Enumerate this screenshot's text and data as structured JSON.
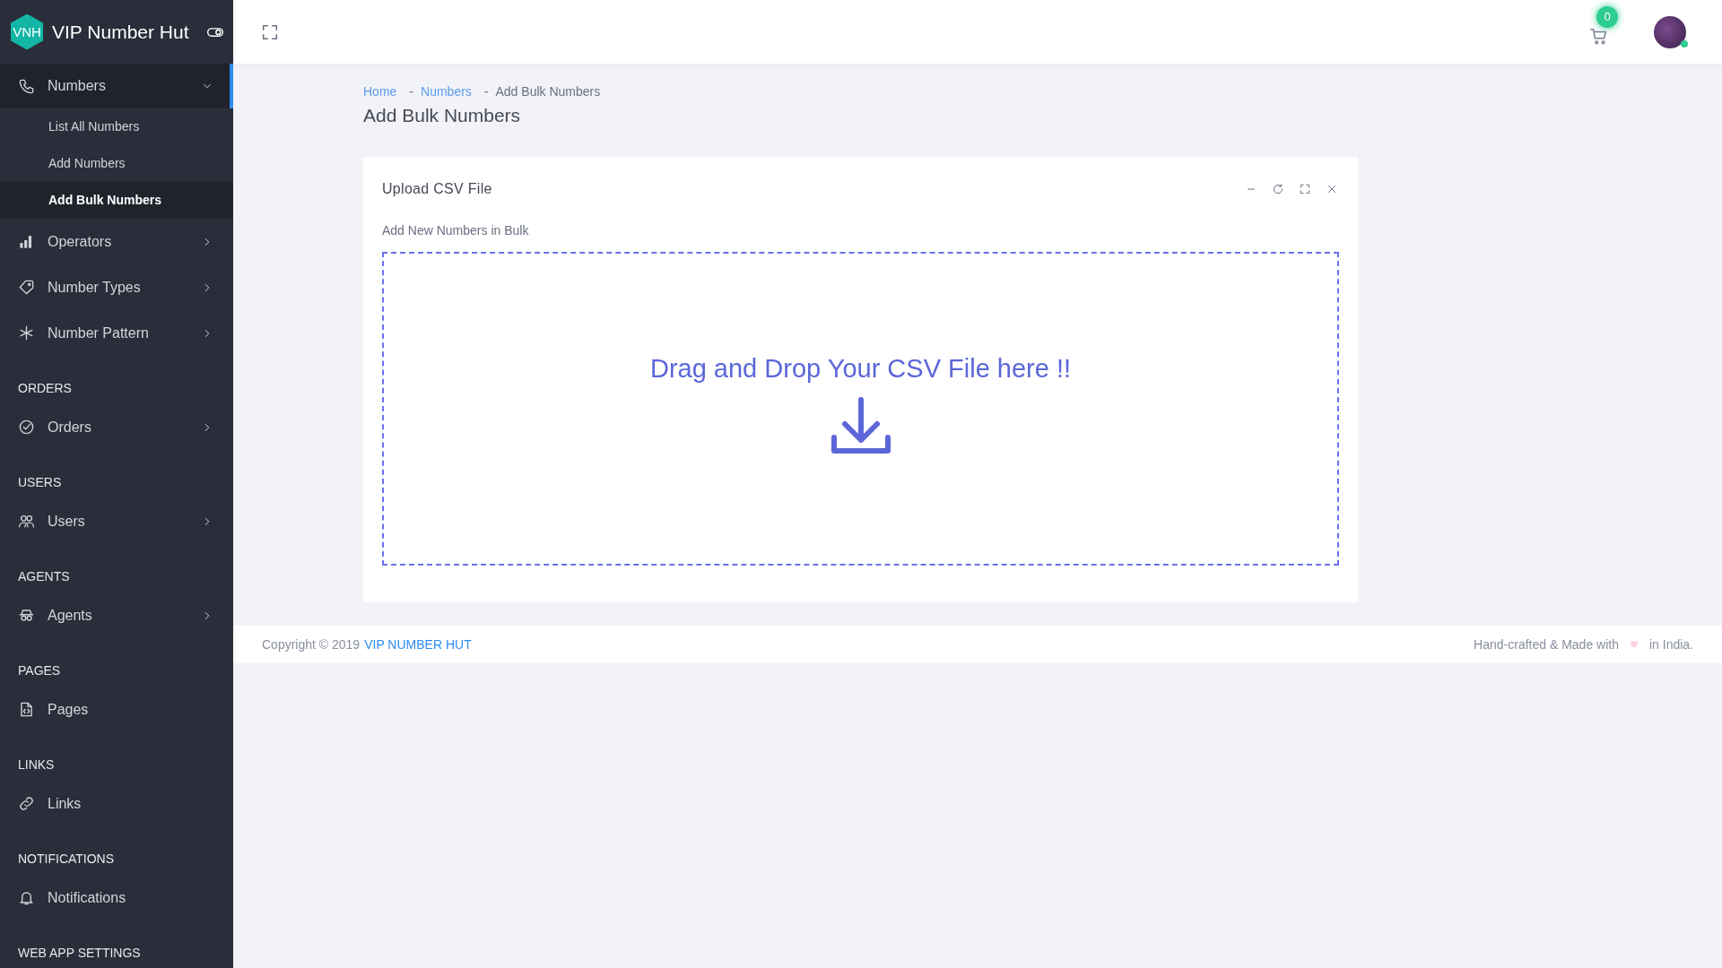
{
  "brand": {
    "logo": "VNH",
    "name": "VIP Number Hut"
  },
  "sidebar": {
    "items": [
      {
        "kind": "item",
        "label": "Numbers",
        "selected": true,
        "expanded": true,
        "children": [
          {
            "label": "List All Numbers",
            "selected": false
          },
          {
            "label": "Add Numbers",
            "selected": false
          },
          {
            "label": "Add Bulk Numbers",
            "selected": true
          }
        ]
      },
      {
        "kind": "item",
        "label": "Operators",
        "selected": false,
        "expanded": false
      },
      {
        "kind": "item",
        "label": "Number Types",
        "selected": false,
        "expanded": false
      },
      {
        "kind": "item",
        "label": "Number Pattern",
        "selected": false,
        "expanded": false
      },
      {
        "kind": "heading",
        "label": "ORDERS"
      },
      {
        "kind": "item",
        "label": "Orders",
        "selected": false,
        "expanded": false
      },
      {
        "kind": "heading",
        "label": "USERS"
      },
      {
        "kind": "item",
        "label": "Users",
        "selected": false,
        "expanded": false
      },
      {
        "kind": "heading",
        "label": "AGENTS"
      },
      {
        "kind": "item",
        "label": "Agents",
        "selected": false,
        "expanded": false
      },
      {
        "kind": "heading",
        "label": "PAGES"
      },
      {
        "kind": "item",
        "label": "Pages",
        "selected": false
      },
      {
        "kind": "heading",
        "label": "LINKS"
      },
      {
        "kind": "item",
        "label": "Links",
        "selected": false
      },
      {
        "kind": "heading",
        "label": "NOTIFICATIONS"
      },
      {
        "kind": "item",
        "label": "Notifications",
        "selected": false
      },
      {
        "kind": "heading",
        "label": "WEB APP SETTINGS"
      }
    ]
  },
  "topbar": {
    "cart_count": "0",
    "user_online": true
  },
  "breadcrumb": [
    {
      "label": "Home",
      "kind": "link"
    },
    {
      "label": "Numbers",
      "kind": "link",
      "separator": "-"
    },
    {
      "label": "Add Bulk Numbers",
      "kind": "current",
      "separator": "-"
    }
  ],
  "page_title": "Add Bulk Numbers",
  "card": {
    "title": "Upload CSV File",
    "label": "Add New Numbers in Bulk",
    "dropzone_text": "Drag and Drop Your CSV File here !!"
  },
  "footer": {
    "copyright": "Copyright © 2019",
    "link": "VIP NUMBER HUT",
    "credit_before": "Hand-crafted & Made with",
    "credit_after": "in India."
  }
}
